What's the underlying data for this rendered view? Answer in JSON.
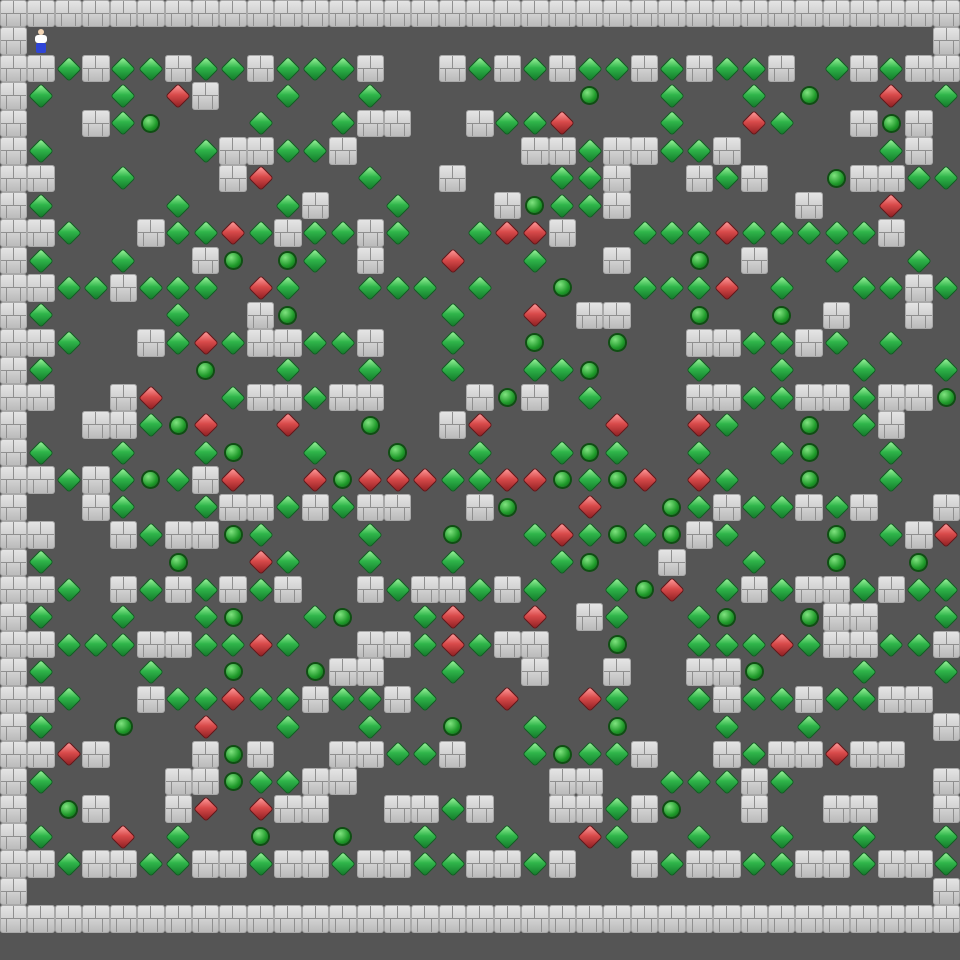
{
  "game": {
    "title": "",
    "colors": {
      "floor": "#555555",
      "wall": "#d9d9d9",
      "goal": "#22a33a",
      "box_on_goal": "#27a844",
      "box_off_goal": "#cf4343",
      "player_body": "#ffffff",
      "player_legs": "#2f45d6"
    },
    "legend": {
      "#": "wall",
      ".": "goal",
      "*": "box on goal",
      "$": "box",
      "@": "player",
      " ": "floor"
    },
    "map_rows": [
      "###################################",
      "#@                                #",
      "##*#**#**#***#  #*#*#**#*#**# *#*##",
      "#*  * $#  *  *       .  *  * .  $ *#",
      "#  #*.   *  *##  #**$   *  $*  #.#",
      "#*     *##**#      ##*##**#     *#",
      "##  *   #$   *  #   **#  #*#  .##**##",
      "#*    *   *#  *   #.**#      #  $  *#",
      "##*  #**$*#**#*  *$$#  ***$*****#  **#",
      "#*  *  #. .* #  $  *  #  . #  *  *  *#",
      "##**#*** $*  *** *  .  ***$ *  **#***##",
      "#*    *  #.     *  $ ##  .  . #  #  *#",
      "##*  #*$*##**#  *  .  .  ##**#* *  *$#**##",
      "#*     .  *  *  *  **.   *  *  *  *$  #*#",
      "##  #$  *##*##   #.# *   ##**##*##.#  ##",
      "#  ##*.$  $  .  #$    $  $*  . *#  #",
      "#*  *  *.  *  .  *  *.*  *  *.  *   #",
      "##*#*.*#$  $.$$$**$$.*.$ $*  .  *  *#",
      "#  #*  *##*#*##  #.  $  .*#**#*#  #*#",
      "##  #*##.*   *  .  *$*.*.#*   . *#$*#",
      "#*    .  $*  *  *   *.  #  *  .  .  #",
      "##* #*#*#*#  #*##*#*  *.$ *#*##*#**##*##",
      "#*  *  *.  *.  *$  $ #*  *.  .##  *  *#",
      "##***##**$*  ##*$*##  .  ***$*##**#**##",
      "#*   *  .  .##  *  #  #  ##.   *  *#",
      "##*  #**$**#**#*  $  $*  *#**#**## **##",
      "#*  .  $  *  *  .  *  .   *  *    ##",
      "##$#   #.#  ##**#  *.**#  #*##$##  ##*##",
      "#*    ##.**##       ##  ***#*     ##",
      "# .#  #$ $##  ##*#  ##*#.  #  ##  ##*#",
      "#*  $ *  .  .  *  *  $*  *  *  *  *#",
      "##*##**##*##*##**##*#  #*##**##*##*#  *##",
      "#                                 #",
      "###################################"
    ],
    "summary": {
      "rows": 35,
      "columns": 35
    }
  }
}
